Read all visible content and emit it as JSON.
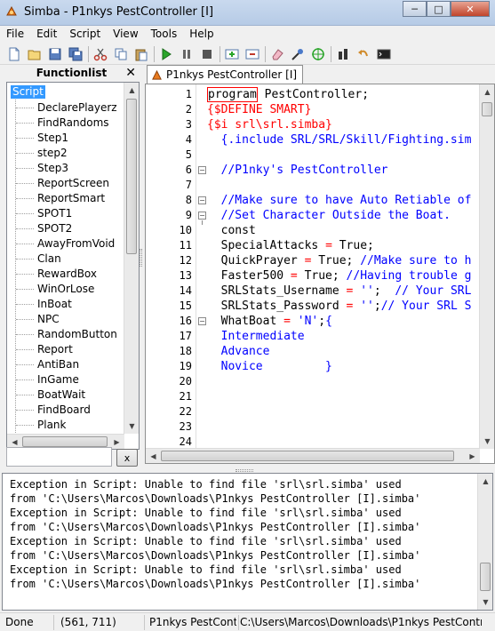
{
  "window": {
    "title": "Simba - P1nkys PestController [I]",
    "min_label": "─",
    "max_label": "□",
    "close_label": "✕"
  },
  "menu": [
    "File",
    "Edit",
    "Script",
    "View",
    "Tools",
    "Help"
  ],
  "toolbar": {
    "buttons": [
      "new-icon",
      "open-icon",
      "save-icon",
      "save-all-icon",
      "cut-icon",
      "copy-icon",
      "paste-icon",
      "run-icon",
      "pause-icon",
      "stop-icon",
      "new-tab-icon",
      "close-tab-icon",
      "eraser-icon",
      "color-picker-icon",
      "target-icon",
      "plugin-icon",
      "undo-icon",
      "console-icon"
    ]
  },
  "functionlist": {
    "title": "Functionlist",
    "close_label": "✕",
    "root": "Script",
    "items": [
      "DeclarePlayerz",
      "FindRandoms",
      "Step1",
      "step2",
      "Step3",
      "ReportScreen",
      "ReportSmart",
      "SPOT1",
      "SPOT2",
      "AwayFromVoid",
      "Clan",
      "RewardBox",
      "WinOrLose",
      "InBoat",
      "NPC",
      "RandomButton",
      "Report",
      "AntiBan",
      "InGame",
      "BoatWait",
      "FindBoard",
      "Plank"
    ],
    "search_value": "",
    "clear_label": "x"
  },
  "editor": {
    "tab_label": "P1nkys PestController [I]",
    "line_numbers": [
      "1",
      "2",
      "3",
      "4",
      "5",
      "6",
      "7",
      "8",
      "9",
      "10",
      "11",
      "12",
      "13",
      "14",
      "15",
      "16",
      "17",
      "18",
      "19",
      "20",
      "21",
      "22",
      "23",
      "24"
    ],
    "lines": [
      {
        "segments": [
          {
            "t": "program",
            "c": "kw-box"
          },
          {
            "t": " PestController;",
            "c": "normal"
          }
        ]
      },
      {
        "segments": [
          {
            "t": "{$DEFINE SMART}",
            "c": "dir"
          }
        ]
      },
      {
        "segments": [
          {
            "t": "{$i srl\\srl.simba}",
            "c": "dir"
          }
        ]
      },
      {
        "segments": [
          {
            "t": "  {.include SRL/SRL/Skill/Fighting.sim",
            "c": "cmt"
          }
        ]
      },
      {
        "segments": [
          {
            "t": "",
            "c": "normal"
          }
        ]
      },
      {
        "segments": [
          {
            "t": "  //P1nky's PestController",
            "c": "cmt"
          }
        ]
      },
      {
        "segments": [
          {
            "t": "",
            "c": "normal"
          }
        ]
      },
      {
        "segments": [
          {
            "t": "  //Make sure to have Auto Retiable of",
            "c": "cmt"
          }
        ]
      },
      {
        "segments": [
          {
            "t": "  //Set Character Outside the Boat.",
            "c": "cmt"
          }
        ]
      },
      {
        "segments": [
          {
            "t": "  const",
            "c": "normal"
          }
        ]
      },
      {
        "segments": [
          {
            "t": "  SpecialAttacks ",
            "c": "normal"
          },
          {
            "t": "=",
            "c": "dir"
          },
          {
            "t": " True;",
            "c": "normal"
          }
        ]
      },
      {
        "segments": [
          {
            "t": "  QuickPrayer ",
            "c": "normal"
          },
          {
            "t": "=",
            "c": "dir"
          },
          {
            "t": " True; ",
            "c": "normal"
          },
          {
            "t": "//Make sure to h",
            "c": "cmt"
          }
        ]
      },
      {
        "segments": [
          {
            "t": "  Faster500 ",
            "c": "normal"
          },
          {
            "t": "=",
            "c": "dir"
          },
          {
            "t": " True; ",
            "c": "normal"
          },
          {
            "t": "//Having trouble g",
            "c": "cmt"
          }
        ]
      },
      {
        "segments": [
          {
            "t": "  SRLStats_Username ",
            "c": "normal"
          },
          {
            "t": "=",
            "c": "dir"
          },
          {
            "t": " ",
            "c": "normal"
          },
          {
            "t": "''",
            "c": "str"
          },
          {
            "t": ";  ",
            "c": "normal"
          },
          {
            "t": "// Your SRL",
            "c": "cmt"
          }
        ]
      },
      {
        "segments": [
          {
            "t": "  SRLStats_Password ",
            "c": "normal"
          },
          {
            "t": "=",
            "c": "dir"
          },
          {
            "t": " ",
            "c": "normal"
          },
          {
            "t": "''",
            "c": "str"
          },
          {
            "t": ";",
            "c": "normal"
          },
          {
            "t": "// Your SRL S",
            "c": "cmt"
          }
        ]
      },
      {
        "segments": [
          {
            "t": "  WhatBoat ",
            "c": "normal"
          },
          {
            "t": "=",
            "c": "dir"
          },
          {
            "t": " ",
            "c": "normal"
          },
          {
            "t": "'N'",
            "c": "str"
          },
          {
            "t": ";",
            "c": "normal"
          },
          {
            "t": "{",
            "c": "cmt"
          }
        ]
      },
      {
        "segments": [
          {
            "t": "  Intermediate",
            "c": "cmt"
          }
        ]
      },
      {
        "segments": [
          {
            "t": "  Advance",
            "c": "cmt"
          }
        ]
      },
      {
        "segments": [
          {
            "t": "  Novice         }",
            "c": "cmt"
          }
        ]
      },
      {
        "segments": [
          {
            "t": "",
            "c": "normal"
          }
        ]
      },
      {
        "segments": [
          {
            "t": "",
            "c": "normal"
          }
        ]
      },
      {
        "segments": [
          {
            "t": "",
            "c": "normal"
          }
        ]
      },
      {
        "segments": [
          {
            "t": "",
            "c": "normal"
          }
        ]
      },
      {
        "segments": [
          {
            "t": "",
            "c": "normal"
          }
        ]
      }
    ]
  },
  "debug": {
    "lines": [
      "Exception in Script: Unable to find file 'srl\\srl.simba' used",
      "from 'C:\\Users\\Marcos\\Downloads\\P1nkys PestController [I].simba'",
      "Exception in Script: Unable to find file 'srl\\srl.simba' used",
      "from 'C:\\Users\\Marcos\\Downloads\\P1nkys PestController [I].simba'",
      "Exception in Script: Unable to find file 'srl\\srl.simba' used",
      "from 'C:\\Users\\Marcos\\Downloads\\P1nkys PestController [I].simba'",
      "Exception in Script: Unable to find file 'srl\\srl.simba' used",
      "from 'C:\\Users\\Marcos\\Downloads\\P1nkys PestController [I].simba'"
    ]
  },
  "status": {
    "state": "Done",
    "coords": "(561, 711)",
    "script_name": "P1nkys PestContro",
    "path": "C:\\Users\\Marcos\\Downloads\\P1nkys PestController"
  }
}
